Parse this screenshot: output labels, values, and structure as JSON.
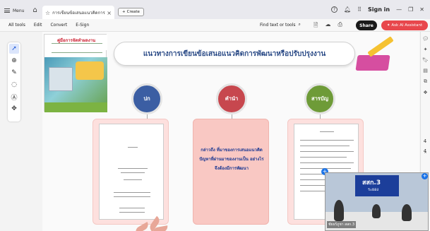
{
  "titlebar": {
    "menu_label": "Menu",
    "tab_title": "การเขียนข้อเสนอแนวคิดการพัฒ...",
    "create_label": "Create",
    "signin_label": "Sign in"
  },
  "toolbar": {
    "items": [
      "All tools",
      "Edit",
      "Convert",
      "E-Sign"
    ],
    "find_label": "Find text or tools",
    "share_label": "Share",
    "ask_ai_label": "Ask AI Assistant"
  },
  "slide": {
    "banner_title": "แนวทางการเขียนข้อเสนอแนวคิดการพัฒนาหรือปรับปรุงงาน",
    "book_title": "คู่มือการจัดทำผลงาน",
    "circles": [
      {
        "label": "ปก",
        "color": "#3b5ea3"
      },
      {
        "label": "คำนำ",
        "color": "#c7474e"
      },
      {
        "label": "สารบัญ",
        "color": "#6e9b38"
      }
    ],
    "card_text": "กล่าวถึง ที่มาของการเสนอแนวคิด ปัญหาที่ผ่านมาของงานเป็น อย่างไร จึงต้องมีการพัฒนา"
  },
  "rightrail": {
    "page_numbers": [
      "4",
      "4"
    ]
  },
  "video": {
    "banner_title": "สสก.3",
    "banner_subtitle": "ระยอง",
    "participant_label": "ชัยธร์ภูชา สสก.3"
  }
}
